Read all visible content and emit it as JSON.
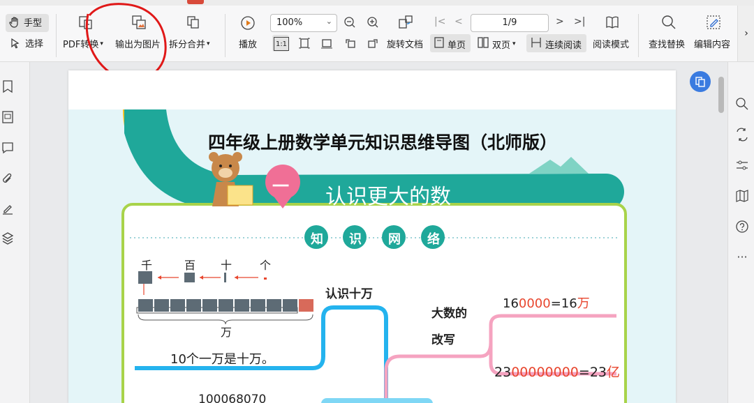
{
  "toolbar": {
    "hand_label": "手型",
    "select_label": "选择",
    "pdf_convert_label": "PDF转换",
    "export_image_label": "输出为图片",
    "split_merge_label": "拆分合并",
    "play_label": "播放",
    "zoom_value": "100%",
    "page_value": "1/9",
    "rotate_doc_label": "旋转文档",
    "single_page_label": "单页",
    "double_page_label": "双页",
    "continuous_label": "连续阅读",
    "reading_mode_label": "阅读模式",
    "find_replace_label": "查找替换",
    "edit_content_label": "编辑内容",
    "actual_size_label": "1:1"
  },
  "document": {
    "title": "四年级上册数学单元知识思维导图（北师版）",
    "unit_number": "一",
    "unit_title": "认识更大的数",
    "section_chars": [
      "知",
      "识",
      "网",
      "络"
    ],
    "place_values": [
      "千",
      "百",
      "十",
      "个"
    ],
    "wan_label": "万",
    "ten_wan_text": "10个一万是十万。",
    "recognize_label": "认识十万",
    "rewrite_label_1": "大数的",
    "rewrite_label_2": "改写",
    "eq1_black1": "16",
    "eq1_red": "0000",
    "eq1_black2": "=16",
    "eq1_unit": "万",
    "eq2_black1": "23",
    "eq2_red": "00000000",
    "eq2_black2": "=23",
    "eq2_unit": "亿",
    "bottom_number": "100068070"
  },
  "colors": {
    "accent_teal": "#1fa89a",
    "pink": "#f06f96",
    "blue_branch": "#24b3ee",
    "pink_branch": "#f5a3c0",
    "red_text": "#e8462e",
    "annotation_red": "#e01818"
  }
}
